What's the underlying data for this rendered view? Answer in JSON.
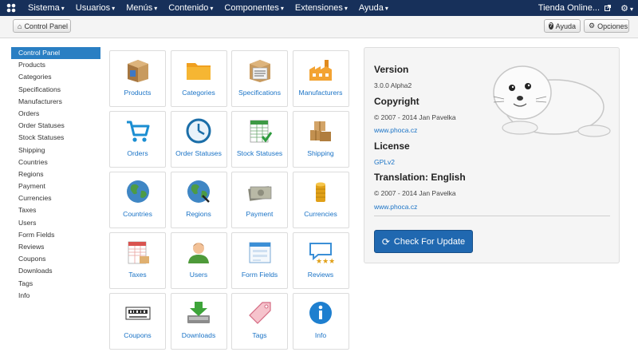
{
  "nav": {
    "menus": [
      {
        "label": "Sistema"
      },
      {
        "label": "Usuarios"
      },
      {
        "label": "Menús"
      },
      {
        "label": "Contenido"
      },
      {
        "label": "Componentes"
      },
      {
        "label": "Extensiones"
      },
      {
        "label": "Ayuda"
      }
    ],
    "site_label": "Tienda Online...",
    "logo_icon": "joomla-logo-icon",
    "external_icon": "external-link-icon",
    "settings_icon": "gear-icon"
  },
  "toolbar": {
    "control_panel_label": "Control Panel",
    "help_label": "Ayuda",
    "options_label": "Opciones"
  },
  "sidebar": {
    "items": [
      "Control Panel",
      "Products",
      "Categories",
      "Specifications",
      "Manufacturers",
      "Orders",
      "Order Statuses",
      "Stock Statuses",
      "Shipping",
      "Countries",
      "Regions",
      "Payment",
      "Currencies",
      "Taxes",
      "Users",
      "Form Fields",
      "Reviews",
      "Coupons",
      "Downloads",
      "Tags",
      "Info"
    ],
    "active": "Control Panel"
  },
  "tiles": [
    {
      "label": "Products",
      "icon": "product-box-icon"
    },
    {
      "label": "Categories",
      "icon": "folder-icon"
    },
    {
      "label": "Specifications",
      "icon": "spec-box-icon"
    },
    {
      "label": "Manufacturers",
      "icon": "factory-icon"
    },
    {
      "label": "Orders",
      "icon": "cart-icon"
    },
    {
      "label": "Order Statuses",
      "icon": "clock-icon"
    },
    {
      "label": "Stock Statuses",
      "icon": "spreadsheet-icon"
    },
    {
      "label": "Shipping",
      "icon": "boxes-icon"
    },
    {
      "label": "Countries",
      "icon": "globe-icon"
    },
    {
      "label": "Regions",
      "icon": "globe-icon"
    },
    {
      "label": "Payment",
      "icon": "money-icon"
    },
    {
      "label": "Currencies",
      "icon": "coins-icon"
    },
    {
      "label": "Taxes",
      "icon": "tax-icon"
    },
    {
      "label": "Users",
      "icon": "user-icon"
    },
    {
      "label": "Form Fields",
      "icon": "form-icon"
    },
    {
      "label": "Reviews",
      "icon": "review-icon"
    },
    {
      "label": "Coupons",
      "icon": "coupon-icon"
    },
    {
      "label": "Downloads",
      "icon": "download-icon"
    },
    {
      "label": "Tags",
      "icon": "tag-icon"
    },
    {
      "label": "Info",
      "icon": "info-icon"
    }
  ],
  "info": {
    "version_heading": "Version",
    "version": "3.0.0 Alpha2",
    "copyright_heading": "Copyright",
    "copyright": "© 2007 - 2014 Jan Pavelka",
    "copyright_link": "www.phoca.cz",
    "license_heading": "License",
    "license": "GPLv2",
    "translation_heading": "Translation: English",
    "translation_copyright": "© 2007 - 2014 Jan Pavelka",
    "translation_link": "www.phoca.cz",
    "update_button": "Check For Update",
    "mascot": "phoca-seal-logo"
  },
  "colors": {
    "navbar": "#17305a",
    "accent": "#2a7fc3",
    "link": "#1a73c6",
    "update_button": "#2068b0"
  }
}
